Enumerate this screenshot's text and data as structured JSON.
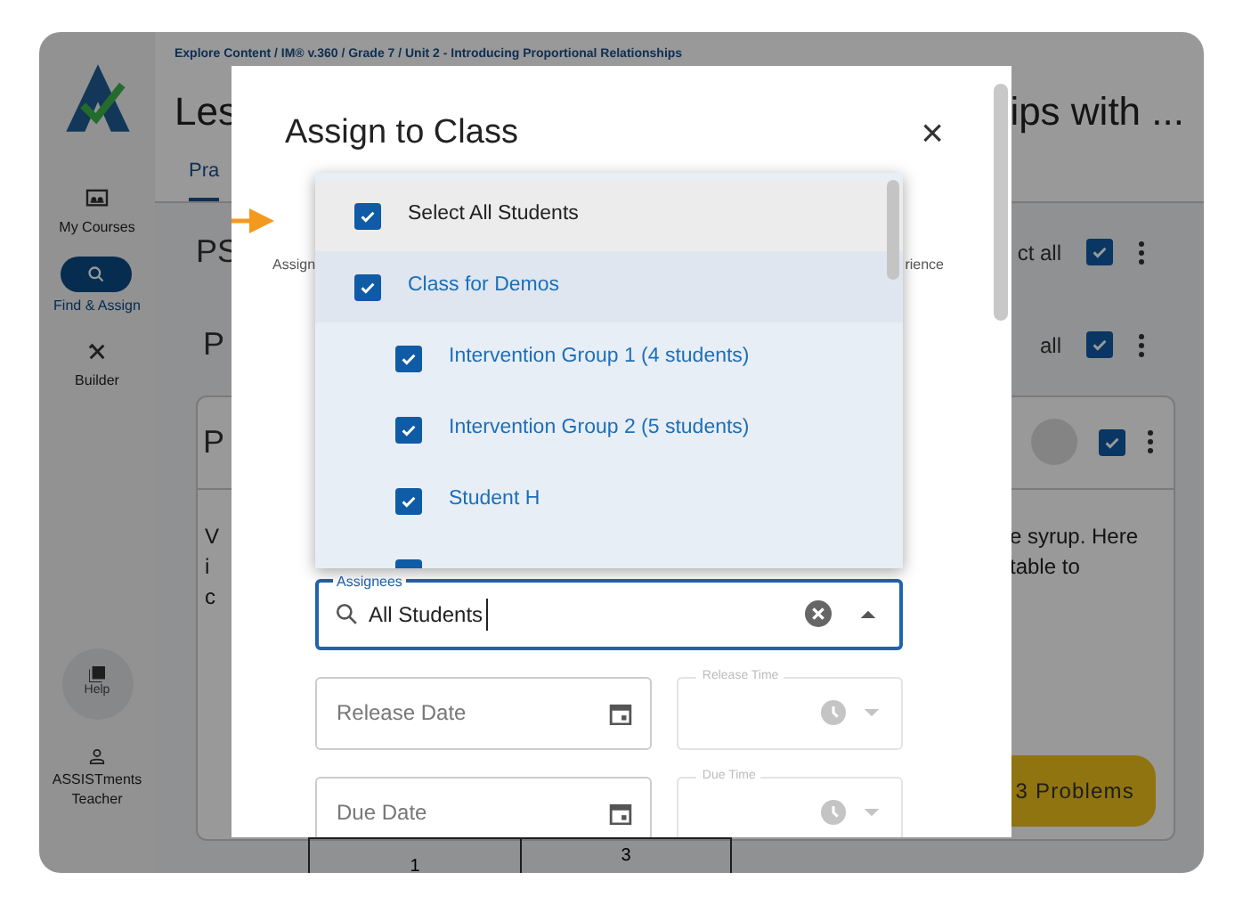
{
  "sidebar": {
    "items": [
      {
        "label": "My Courses",
        "selected": false
      },
      {
        "label": "Find & Assign",
        "selected": true
      },
      {
        "label": "Builder",
        "selected": false
      }
    ],
    "help": "Help",
    "user": "ASSISTments Teacher"
  },
  "page": {
    "breadcrumb": "Explore Content / IM® v.360 / Grade 7 / Unit 2 - Introducing Proportional Relationships",
    "title_start": "Les",
    "title_end": "ips with ...",
    "tab": "Pra",
    "section_heading": "PS",
    "section_select": "ct all",
    "section_checked": true,
    "sub_heading": "P",
    "sub_select": "all",
    "sub_checked": true,
    "card": {
      "heading": "P",
      "checked": true,
      "text_start": [
        "V",
        "i",
        "c"
      ],
      "text_end": [
        "e syrup. Here",
        "table to"
      ]
    },
    "assign_button": "3 Problems",
    "table_cells": [
      "1",
      "3"
    ]
  },
  "modal": {
    "title": "Assign to Class",
    "close": "×",
    "hint_start": "Assign",
    "hint_end": "rience",
    "dropdown": [
      {
        "kind": "all",
        "label": "Select All Students",
        "checked": true,
        "pointed": true
      },
      {
        "kind": "class",
        "label": "Class for Demos",
        "checked": true,
        "children": [
          {
            "label": "Intervention Group 1 (4 students)",
            "checked": true
          },
          {
            "label": "Intervention Group 2 (5 students)",
            "checked": true
          },
          {
            "label": "Student H",
            "checked": true
          },
          {
            "checked": true
          }
        ]
      }
    ],
    "assignees": {
      "label": "Assignees",
      "value": "All Students"
    },
    "fields": [
      {
        "date_placeholder": "Release Date",
        "time_label": "Release Time"
      },
      {
        "date_placeholder": "Due Date",
        "time_label": "Due Time"
      }
    ]
  }
}
